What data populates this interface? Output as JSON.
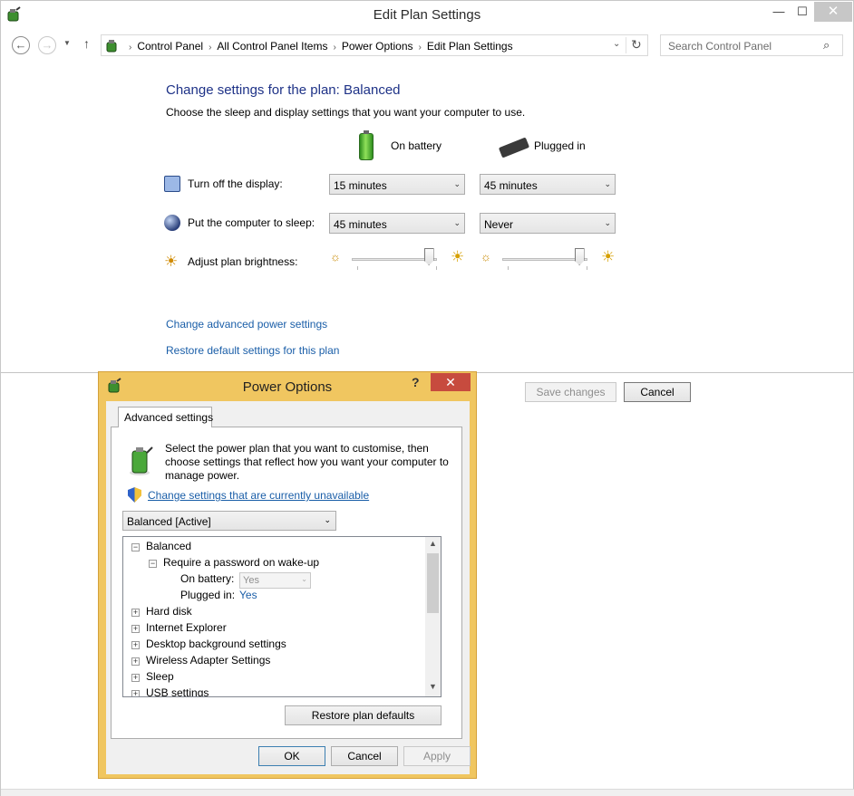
{
  "window": {
    "title": "Edit Plan Settings",
    "minimize": "—",
    "maximize": "☐",
    "close": "✕"
  },
  "nav": {
    "back": "←",
    "forward": "→",
    "recent": "▼",
    "up": "↑",
    "breadcrumbs": [
      "Control Panel",
      "All Control Panel Items",
      "Power Options",
      "Edit Plan Settings"
    ],
    "separator": "›",
    "dropdown": "⌄",
    "refresh": "↻",
    "search_placeholder": "Search Control Panel",
    "search_icon": "⌕"
  },
  "plan": {
    "heading": "Change settings for the plan: Balanced",
    "subtext": "Choose the sleep and display settings that you want your computer to use.",
    "on_battery": "On battery",
    "plugged_in": "Plugged in",
    "rows": [
      {
        "label": "Turn off the display:",
        "battery": "15 minutes",
        "plugged": "45 minutes"
      },
      {
        "label": "Put the computer to sleep:",
        "battery": "45 minutes",
        "plugged": "Never"
      }
    ],
    "brightness_label": "Adjust plan brightness:",
    "brightness_battery": 0.9,
    "brightness_plugged": 0.9,
    "link_advanced": "Change advanced power settings",
    "link_restore": "Restore default settings for this plan",
    "save_button": "Save changes",
    "cancel_button": "Cancel",
    "arrow": "⌄",
    "sun_small": "☼",
    "sun_big": "☀"
  },
  "dialog": {
    "title": "Power Options",
    "help": "?",
    "close": "✕",
    "tab": "Advanced settings",
    "description": "Select the power plan that you want to customise, then choose settings that reflect how you want your computer to manage power.",
    "link_unavailable": "Change settings that are currently unavailable",
    "plan_select": "Balanced [Active]",
    "tree": {
      "root": "Balanced",
      "expanded": "Require a password on wake-up",
      "on_battery_label": "On battery:",
      "on_battery_value": "Yes",
      "plugged_label": "Plugged in:",
      "plugged_value": "Yes",
      "items": [
        "Hard disk",
        "Internet Explorer",
        "Desktop background settings",
        "Wireless Adapter Settings",
        "Sleep",
        "USB settings"
      ],
      "minus": "−",
      "plus": "+"
    },
    "restore_button": "Restore plan defaults",
    "ok_button": "OK",
    "cancel_button": "Cancel",
    "apply_button": "Apply"
  },
  "colors": {
    "heading": "#1e3287",
    "link": "#1a5ea8",
    "dialog_frame": "#f0c660",
    "dialog_close": "#c74b3e"
  }
}
